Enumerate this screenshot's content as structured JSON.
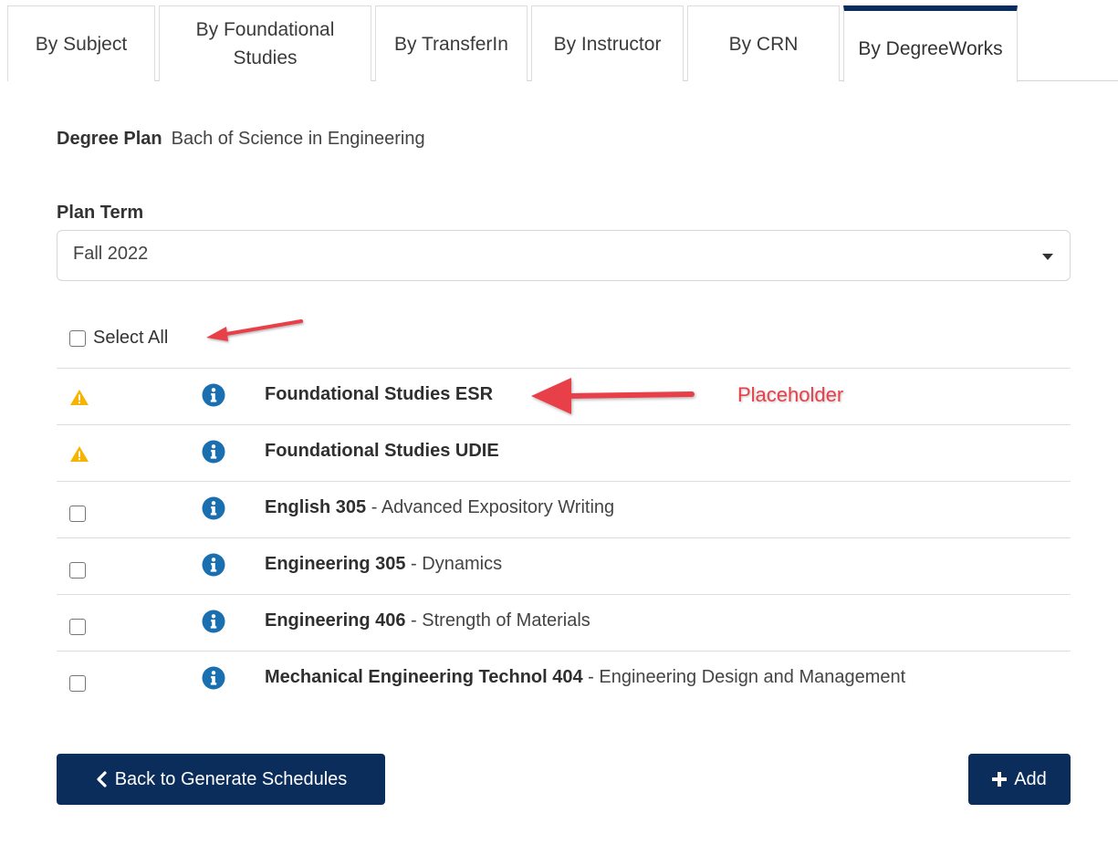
{
  "tabs": [
    {
      "label": "By Subject"
    },
    {
      "label": "By Foundational Studies"
    },
    {
      "label": "By TransferIn"
    },
    {
      "label": "By Instructor"
    },
    {
      "label": "By CRN"
    },
    {
      "label": "By DegreeWorks",
      "active": true
    }
  ],
  "degree_plan": {
    "label": "Degree Plan",
    "value": "Bach of Science in Engineering"
  },
  "plan_term": {
    "label": "Plan Term",
    "selected": "Fall 2022"
  },
  "select_all": {
    "label": "Select All",
    "checked": false
  },
  "courses": [
    {
      "code": "Foundational Studies ESR",
      "desc": "",
      "status": "warning"
    },
    {
      "code": "Foundational Studies UDIE",
      "desc": "",
      "status": "warning"
    },
    {
      "code": "English 305",
      "desc": " - Advanced Expository Writing",
      "status": "checkbox"
    },
    {
      "code": "Engineering 305",
      "desc": " - Dynamics",
      "status": "checkbox"
    },
    {
      "code": "Engineering 406",
      "desc": " - Strength of Materials",
      "status": "checkbox"
    },
    {
      "code": "Mechanical Engineering Technol 404",
      "desc": " - Engineering Design and Management",
      "status": "checkbox"
    }
  ],
  "annotation": {
    "label": "Placeholder"
  },
  "buttons": {
    "back": "Back to Generate Schedules",
    "add": "Add"
  },
  "colors": {
    "primary": "#0b2d5b",
    "warning": "#f5b400",
    "info": "#1a6fb0",
    "annotation": "#e8404a"
  }
}
